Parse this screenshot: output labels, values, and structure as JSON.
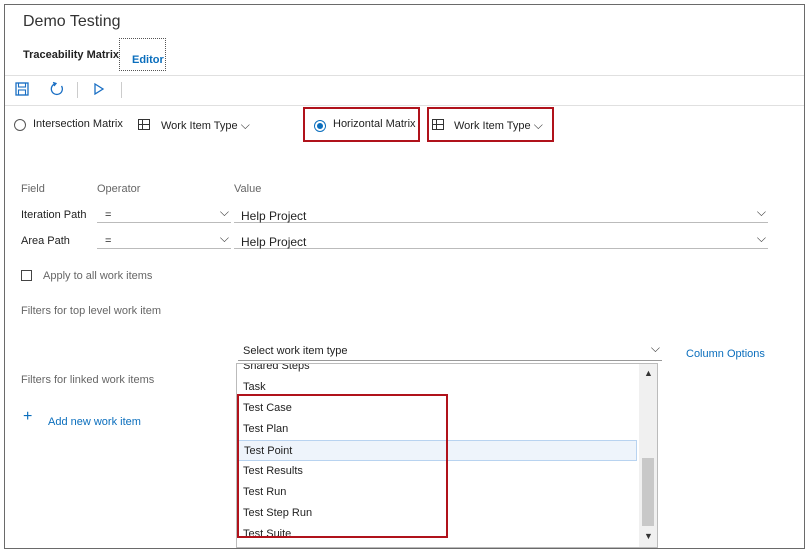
{
  "app": {
    "title": "Demo Testing"
  },
  "tabs": [
    {
      "label": "Traceability Matrix"
    },
    {
      "label": "Editor"
    }
  ],
  "toolbar": {
    "save_icon": "save-icon",
    "refresh_icon": "refresh-icon",
    "run_icon": "play-icon"
  },
  "modes": {
    "intersection_label": "Intersection Matrix",
    "intersection_wit_label": "Work Item Type",
    "horizontal_label": "Horizontal Matrix",
    "horizontal_wit_label": "Work Item Type"
  },
  "filters": {
    "headers": {
      "field": "Field",
      "operator": "Operator",
      "value": "Value"
    },
    "rows": [
      {
        "field": "Iteration Path",
        "operator": "=",
        "value": "Help Project"
      },
      {
        "field": "Area Path",
        "operator": "=",
        "value": "Help Project"
      }
    ],
    "apply_all_label": "Apply to all work items",
    "top_level_label": "Filters for top level work item",
    "linked_label": "Filters for linked work items",
    "add_new_label": "Add new work item"
  },
  "column_options_label": "Column Options",
  "work_item_select": {
    "placeholder": "Select work item type",
    "items": [
      "Shared Steps",
      "Task",
      "Test Case",
      "Test Plan",
      "Test Point",
      "Test Results",
      "Test Run",
      "Test Step Run",
      "Test Suite"
    ],
    "highlighted": "Test Point"
  },
  "colors": {
    "accent": "#0a6ebd",
    "annotation": "#b0121b"
  }
}
